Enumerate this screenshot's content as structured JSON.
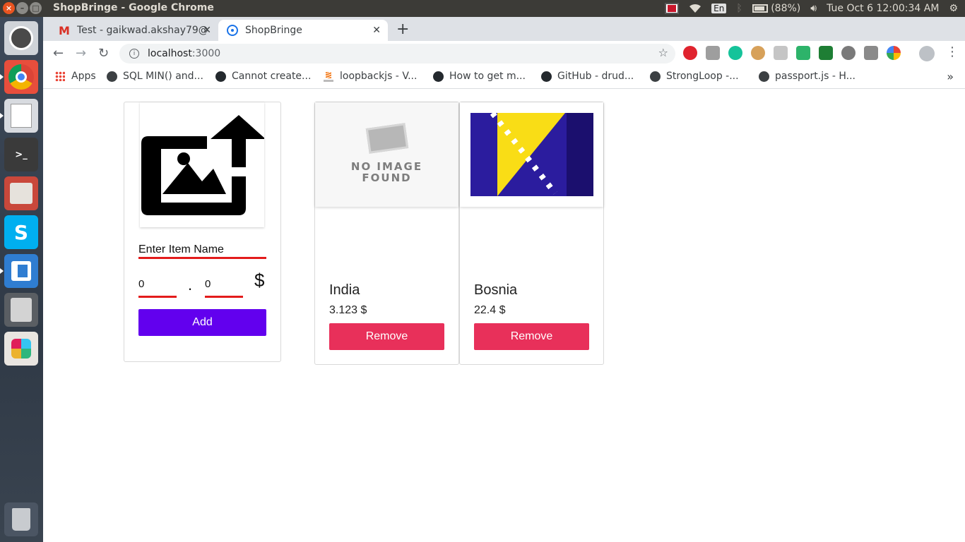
{
  "system": {
    "window_title": "ShopBringe - Google Chrome",
    "keyboard_layout": "En",
    "battery": "(88%)",
    "clock": "Tue Oct  6 12:00:34 AM"
  },
  "launcher": {
    "apps": [
      "ubuntu-dash-icon",
      "chrome-icon",
      "text-editor-icon",
      "terminal-icon",
      "files-icon",
      "skype-icon",
      "vscode-icon",
      "calculator-icon",
      "slack-icon",
      "trash-icon"
    ],
    "terminal_glyph": ">_",
    "skype_glyph": "S"
  },
  "browser": {
    "tabs": [
      {
        "title": "Test - gaikwad.akshay79@",
        "favicon": "gmail-icon"
      },
      {
        "title": "ShopBringe",
        "favicon": "react-icon"
      }
    ],
    "address": {
      "host": "localhost",
      "port": ":3000"
    },
    "bookmarks": [
      {
        "label": "Apps",
        "icon": "apps-icon"
      },
      {
        "label": "SQL MIN() and...",
        "icon": "globe-icon"
      },
      {
        "label": "Cannot create...",
        "icon": "github-icon"
      },
      {
        "label": "loopbackjs - V...",
        "icon": "stackoverflow-icon"
      },
      {
        "label": "How to get m...",
        "icon": "github-icon"
      },
      {
        "label": "GitHub - drud...",
        "icon": "github-icon"
      },
      {
        "label": "StrongLoop -...",
        "icon": "globe-icon"
      },
      {
        "label": "passport.js - H...",
        "icon": "globe-icon"
      }
    ]
  },
  "app": {
    "add_form": {
      "name_placeholder": "Enter Item Name",
      "dollars_value": "0",
      "separator": ".",
      "cents_value": "0",
      "currency_symbol": "$",
      "add_label": "Add",
      "add_color": "#6200ee",
      "underline_color": "#e31b1b"
    },
    "items": [
      {
        "name": "India",
        "price": "3.123 $",
        "remove_label": "Remove",
        "image": "no-image-placeholder",
        "no_image_line1": "NO IMAGE",
        "no_image_line2": "FOUND"
      },
      {
        "name": "Bosnia",
        "price": "22.4 $",
        "remove_label": "Remove",
        "image": "bosnia-flag"
      }
    ],
    "remove_color": "#e8305a"
  }
}
